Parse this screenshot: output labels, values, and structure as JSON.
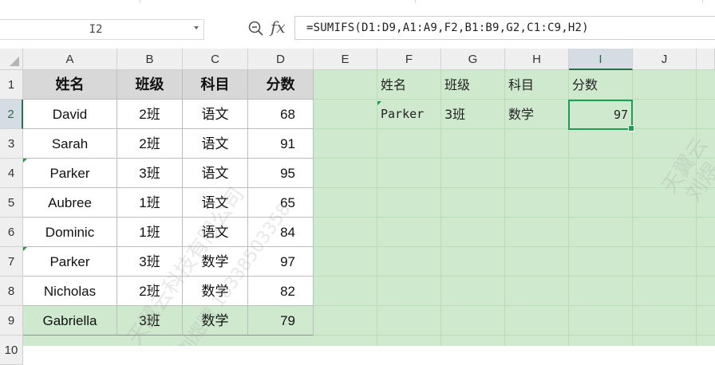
{
  "formula_bar": {
    "name_box": "I2",
    "fx_icon": "fx-icon",
    "formula": "=SUMIFS(D1:D9,A1:A9,F2,B1:B9,G2,C1:C9,H2)"
  },
  "columns": [
    "A",
    "B",
    "C",
    "D",
    "E",
    "F",
    "G",
    "H",
    "I",
    "J"
  ],
  "rows": [
    "1",
    "2",
    "3",
    "4",
    "5",
    "6",
    "7",
    "8",
    "9",
    "10"
  ],
  "selected_column": "I",
  "selected_row": "2",
  "table": {
    "headers": [
      "姓名",
      "班级",
      "科目",
      "分数"
    ],
    "rows": [
      [
        "David",
        "2班",
        "语文",
        "68"
      ],
      [
        "Sarah",
        "2班",
        "语文",
        "91"
      ],
      [
        "Parker",
        "3班",
        "语文",
        "95"
      ],
      [
        "Aubree",
        "1班",
        "语文",
        "65"
      ],
      [
        "Dominic",
        "1班",
        "语文",
        "84"
      ],
      [
        "Parker",
        "3班",
        "数学",
        "97"
      ],
      [
        "Nicholas",
        "2班",
        "数学",
        "82"
      ],
      [
        "Gabriella",
        "3班",
        "数学",
        "79"
      ]
    ]
  },
  "lookup": {
    "headers": [
      "姓名",
      "班级",
      "科目",
      "分数"
    ],
    "values": [
      "Parker",
      "3班",
      "数学",
      "97"
    ]
  },
  "watermark": {
    "lines": [
      "天翼云科技有限公司",
      "刘煜腾 18338503358",
      "天翼云",
      "刘煜"
    ]
  },
  "colors": {
    "accent": "#217346",
    "sheet_fill": "#cfe9cf",
    "header_fill": "#d8d8d8"
  }
}
